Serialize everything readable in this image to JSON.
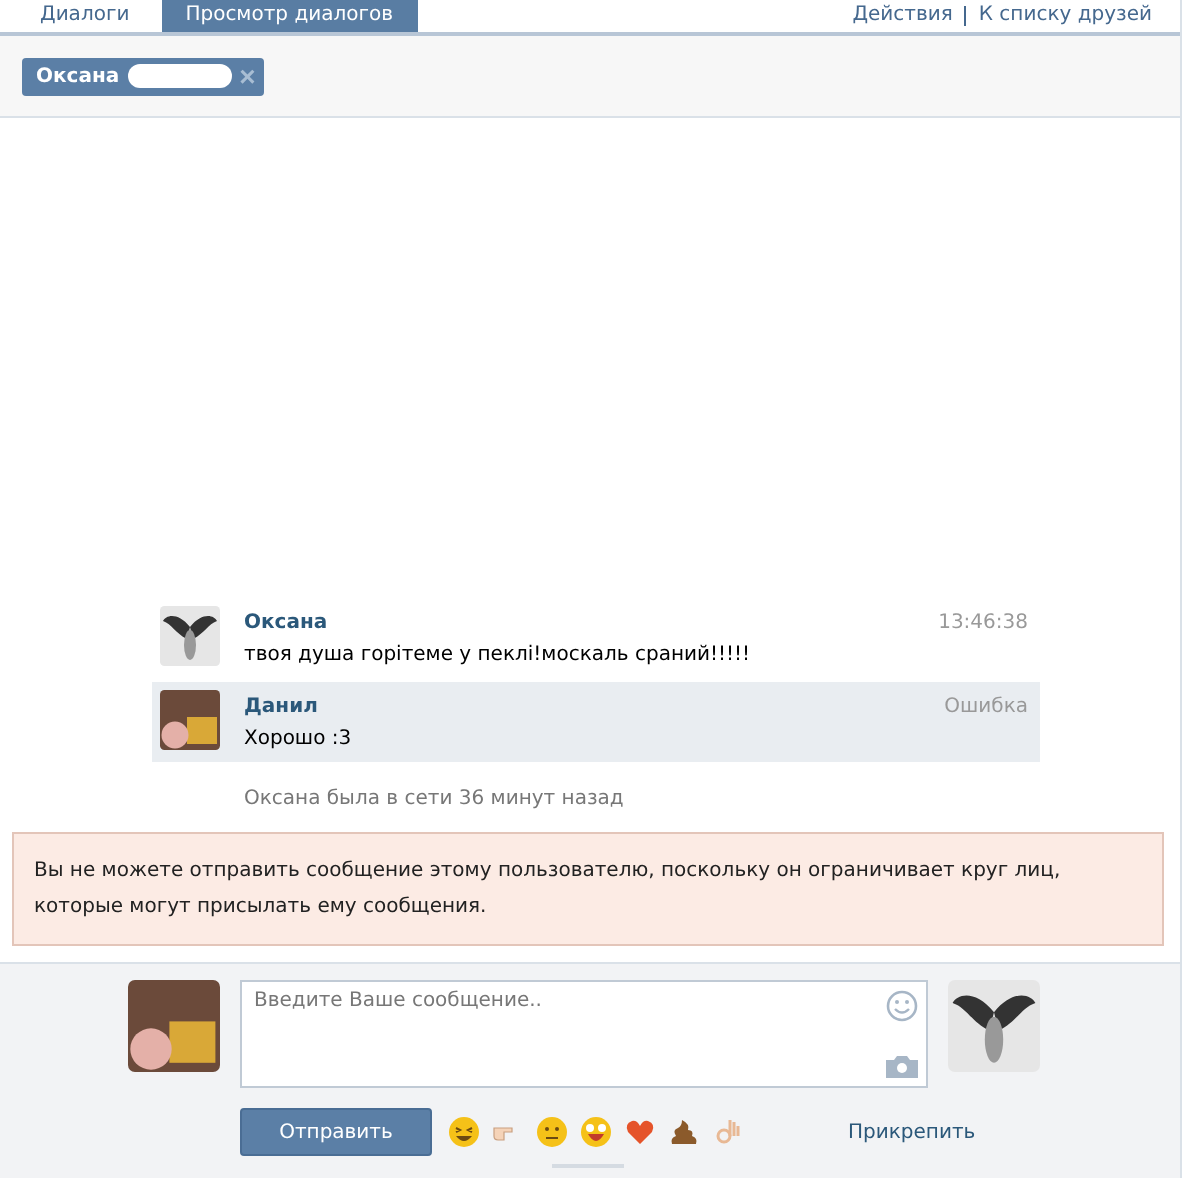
{
  "tabs": [
    {
      "label": "Диалоги",
      "selected": false
    },
    {
      "label": "Просмотр диалогов",
      "selected": true
    }
  ],
  "top_links": [
    "Действия",
    "К списку друзей"
  ],
  "peer_chip": {
    "name": "Оксана",
    "close": "×"
  },
  "messages": [
    {
      "author": "Оксана",
      "text": "твоя душа горітеме у пеклі!москаль сраний!!!!!",
      "status": "13:46:38",
      "highlighted": false,
      "kind": "angel"
    },
    {
      "author": "Данил",
      "text": "Хорошо :3",
      "status": "Ошибка",
      "highlighted": true,
      "kind": "person"
    }
  ],
  "last_seen": "Оксана была в сети 36 минут назад",
  "error_notice": "Вы не можете отправить сообщение этому пользователю, поскольку он ограничивает круг лиц, которые могут присылать ему сообщения.",
  "composer": {
    "placeholder": "Введите Ваше сообщение..",
    "send": "Отправить",
    "attach": "Прикрепить"
  }
}
